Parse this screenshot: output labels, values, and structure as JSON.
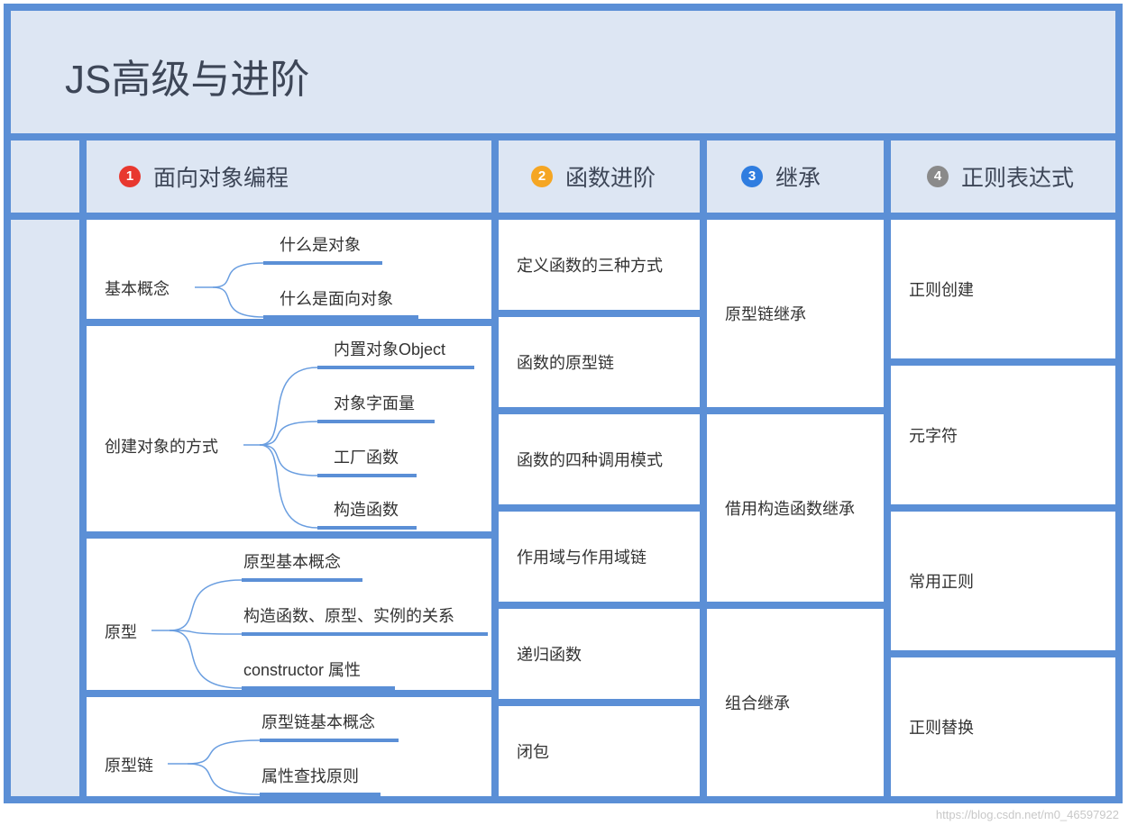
{
  "title": "JS高级与进阶",
  "colors": {
    "frame": "#5b8fd6",
    "header_bg": "#dde6f3",
    "badge_red": "#e8382f",
    "badge_orange": "#f5a623",
    "badge_blue": "#2f7de0",
    "badge_gray": "#8a8a8a",
    "branch_line": "#6a9ee0"
  },
  "columns": [
    {
      "badge": "1",
      "label": "面向对象编程"
    },
    {
      "badge": "2",
      "label": "函数进阶"
    },
    {
      "badge": "3",
      "label": "继承"
    },
    {
      "badge": "4",
      "label": "正则表达式"
    }
  ],
  "oop_groups": [
    {
      "root": "基本概念",
      "leaves": [
        "什么是对象",
        "什么是面向对象"
      ]
    },
    {
      "root": "创建对象的方式",
      "leaves": [
        "内置对象Object",
        "对象字面量",
        "工厂函数",
        "构造函数"
      ]
    },
    {
      "root": "原型",
      "leaves": [
        "原型基本概念",
        "构造函数、原型、实例的关系",
        "constructor 属性"
      ]
    },
    {
      "root": "原型链",
      "leaves": [
        "原型链基本概念",
        "属性查找原则"
      ]
    }
  ],
  "functions": [
    "定义函数的三种方式",
    "函数的原型链",
    "函数的四种调用模式",
    "作用域与作用域链",
    "递归函数",
    "闭包"
  ],
  "inheritance": [
    "原型链继承",
    "借用构造函数继承",
    "组合继承"
  ],
  "regex": [
    "正则创建",
    "元字符",
    "常用正则",
    "正则替换"
  ],
  "watermark": "https://blog.csdn.net/m0_46597922"
}
